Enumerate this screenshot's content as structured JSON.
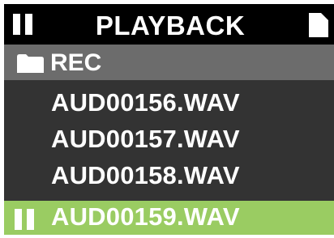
{
  "header": {
    "title": "PLAYBACK",
    "left_icon": "pause-icon",
    "right_icon": "document-icon"
  },
  "folder": {
    "icon": "folder-icon",
    "label": "REC"
  },
  "files": [
    {
      "name": "AUD00156.WAV",
      "selected": false
    },
    {
      "name": "AUD00157.WAV",
      "selected": false
    },
    {
      "name": "AUD00158.WAV",
      "selected": false
    },
    {
      "name": "AUD00159.WAV",
      "selected": true,
      "icon": "pause-icon"
    }
  ],
  "colors": {
    "background": "#333333",
    "header": "#000000",
    "folder_row": "#6c6c6c",
    "selected": "#9acc62",
    "text": "#ffffff"
  }
}
